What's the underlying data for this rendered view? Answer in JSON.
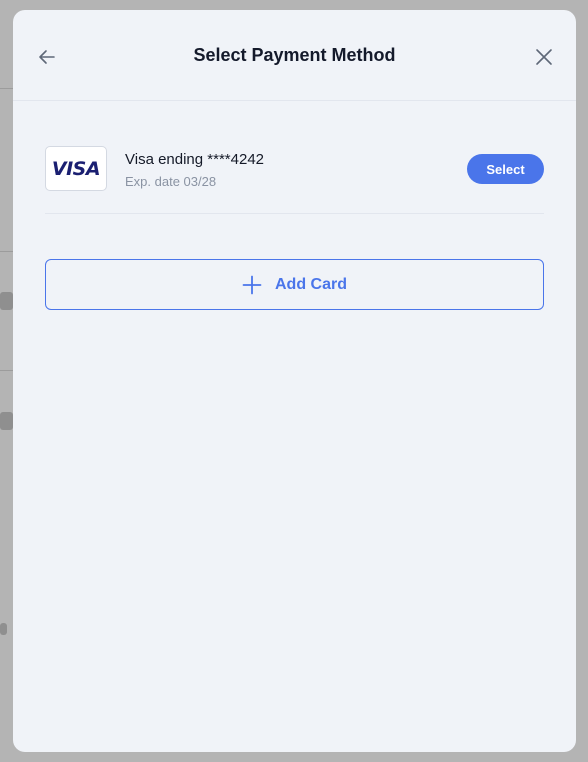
{
  "modal": {
    "title": "Select Payment Method",
    "back_icon": "arrow-left-icon",
    "close_icon": "close-icon"
  },
  "cards": [
    {
      "brand": "VISA",
      "brand_logo": "visa-logo",
      "name": "Visa ending ****4242",
      "expiry": "Exp. date 03/28",
      "select_label": "Select"
    }
  ],
  "add_card": {
    "icon": "plus-icon",
    "label": "Add Card"
  },
  "colors": {
    "accent": "#4a75ea",
    "modal_background": "#f0f3f8",
    "title_text": "#141a2b",
    "muted_text": "#8a93a3",
    "visa_blue": "#1a1f71"
  }
}
